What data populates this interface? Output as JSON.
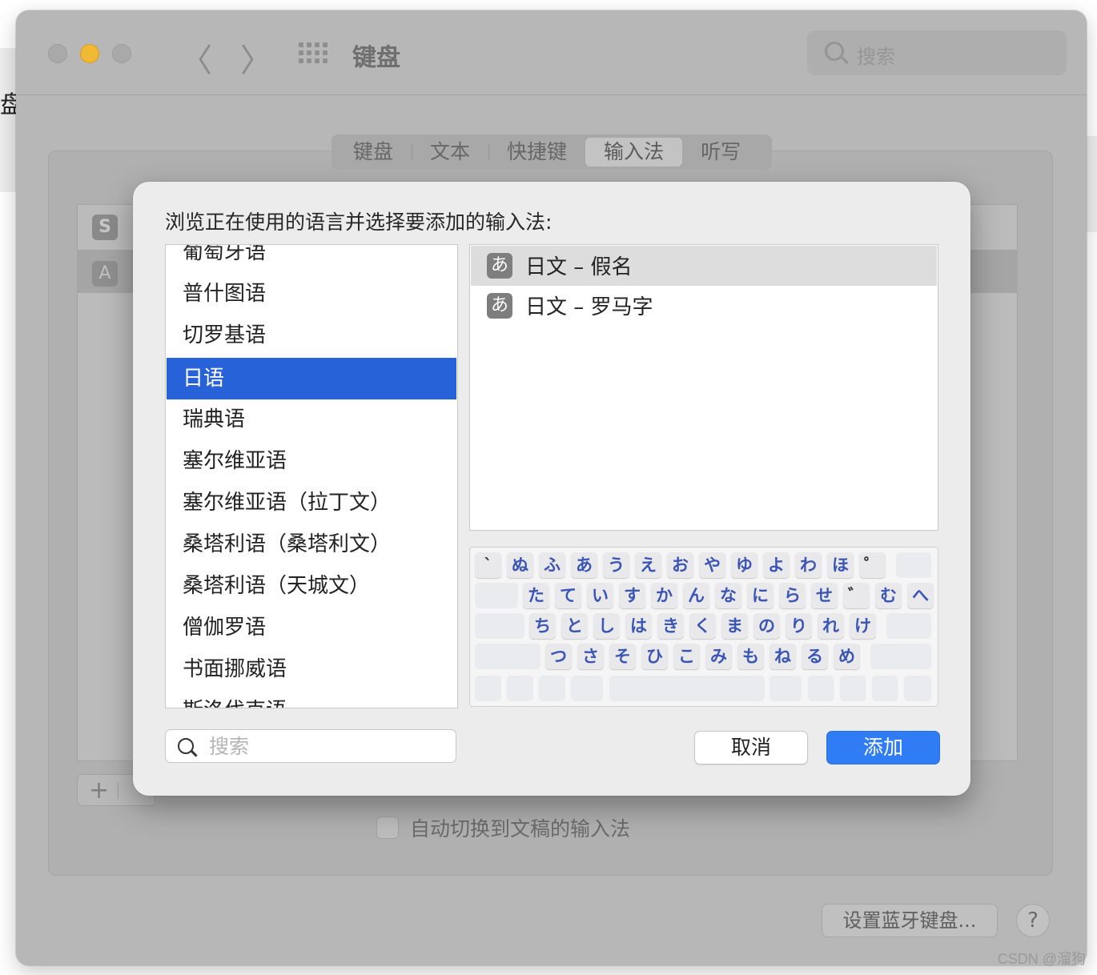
{
  "background_app": {
    "edge_text": "盘f"
  },
  "window": {
    "title": "键盘",
    "search_placeholder": "搜索",
    "nav_back": "〈",
    "nav_forward": "〉",
    "tabs": [
      {
        "label": "键盘"
      },
      {
        "label": "文本"
      },
      {
        "label": "快捷键"
      },
      {
        "label": "输入法",
        "active": true
      },
      {
        "label": "听写"
      }
    ],
    "source_icons": [
      "S",
      "A"
    ],
    "checkbox_label": "自动切换到文稿的输入法",
    "bluetooth_button": "设置蓝牙键盘...",
    "help_button": "?",
    "plus_label": "+"
  },
  "sheet": {
    "prompt": "浏览正在使用的语言并选择要添加的输入法:",
    "languages": [
      "葡萄牙语",
      "普什图语",
      "切罗基语",
      "日语",
      "瑞典语",
      "塞尔维亚语",
      "塞尔维亚语（拉丁文）",
      "桑塔利语（桑塔利文）",
      "桑塔利语（天城文）",
      "僧伽罗语",
      "书面挪威语",
      "斯洛伐克语"
    ],
    "selected_language": "日语",
    "input_methods": [
      {
        "icon": "あ",
        "label": "日文 – 假名",
        "selected": true
      },
      {
        "icon": "あ",
        "label": "日文 – 罗马字",
        "selected": false
      }
    ],
    "keyboard_rows": [
      [
        "`",
        "ぬ",
        "ふ",
        "あ",
        "う",
        "え",
        "お",
        "や",
        "ゆ",
        "よ",
        "わ",
        "ほ",
        "゜"
      ],
      [
        "た",
        "て",
        "い",
        "す",
        "か",
        "ん",
        "な",
        "に",
        "ら",
        "せ",
        "゛",
        "む",
        "へ"
      ],
      [
        "ち",
        "と",
        "し",
        "は",
        "き",
        "く",
        "ま",
        "の",
        "り",
        "れ",
        "け"
      ],
      [
        "つ",
        "さ",
        "そ",
        "ひ",
        "こ",
        "み",
        "も",
        "ね",
        "る",
        "め"
      ]
    ],
    "search_placeholder": "搜索",
    "cancel_label": "取消",
    "add_label": "添加"
  },
  "watermark": "CSDN @溜狗"
}
